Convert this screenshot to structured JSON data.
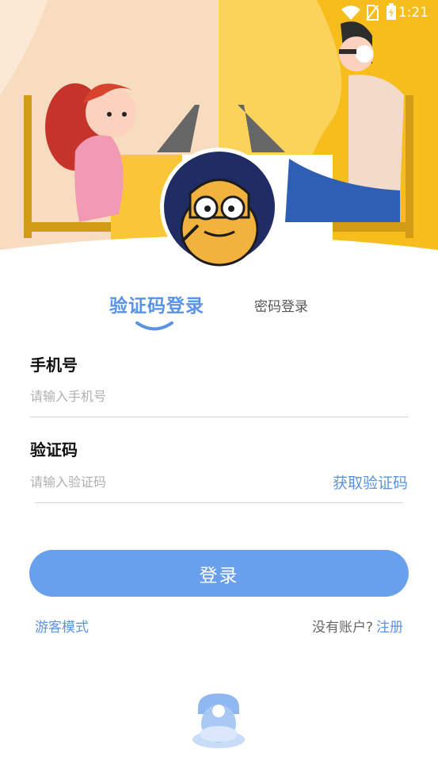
{
  "status_bar": {
    "time": "1:21"
  },
  "tabs": {
    "active": "验证码登录",
    "inactive": "密码登录"
  },
  "phone": {
    "label": "手机号",
    "placeholder": "请输入手机号",
    "value": ""
  },
  "code": {
    "label": "验证码",
    "placeholder": "请输入验证码",
    "value": "",
    "get_code": "获取验证码"
  },
  "login_button": "登录",
  "footer": {
    "guest": "游客模式",
    "no_account": "没有账户?",
    "register": "注册"
  },
  "colors": {
    "accent": "#5a93e6",
    "button": "#68a0ee",
    "hero_left": "#fbe9d6",
    "hero_right": "#f8c938"
  }
}
